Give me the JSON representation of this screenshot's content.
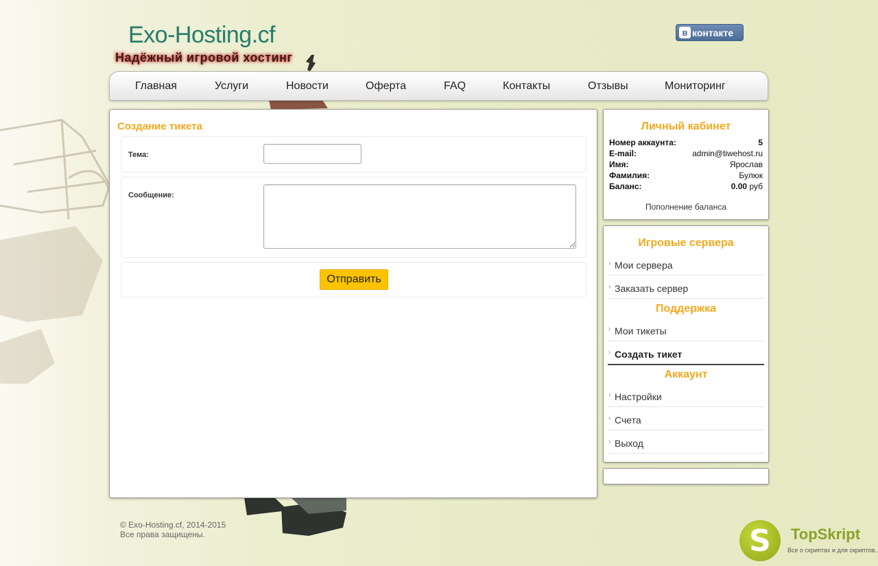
{
  "brand": {
    "title": "Exo-Hosting.cf",
    "tagline": "Надёжный игровой хостинг"
  },
  "social": {
    "vk_label": "контакте",
    "vk_letter": "в"
  },
  "nav": {
    "items": [
      "Главная",
      "Услуги",
      "Новости",
      "Оферта",
      "FAQ",
      "Контакты",
      "Отзывы",
      "Мониторинг"
    ]
  },
  "ticket_form": {
    "title": "Создание тикета",
    "subject_label": "Тема:",
    "subject_value": "",
    "message_label": "Сообщение:",
    "message_value": "",
    "submit_label": "Отправить"
  },
  "account": {
    "title": "Личный кабинет",
    "rows": [
      {
        "key": "Номер аккаунта:",
        "value": "5"
      },
      {
        "key": "E-mail:",
        "value": "admin@tiwehost.ru"
      },
      {
        "key": "Имя:",
        "value": "Ярослав"
      },
      {
        "key": "Фамилия:",
        "value": "Булюк"
      },
      {
        "key": "Баланс:",
        "value": "0.00",
        "unit": "руб"
      }
    ],
    "topup_label": "Пополнение баланса"
  },
  "sidebar": {
    "servers_title": "Игровые сервера",
    "servers_items": [
      "Мои сервера",
      "Заказать сервер"
    ],
    "support_title": "Поддержка",
    "support_items": [
      "Мои тикеты",
      "Создать тикет"
    ],
    "account_title": "Аккаунт",
    "account_items": [
      "Настройки",
      "Счета",
      "Выход"
    ],
    "active_item": "Создать тикет"
  },
  "footer": {
    "copyright": "© Exo-Hosting.cf, 2014-2015",
    "rights": "Все права защищены."
  },
  "watermark": {
    "letter": "S",
    "name": "TopSkript",
    "tagline": "Все о скриптах и для скриптов..."
  },
  "colors": {
    "accent": "#f4a81d",
    "button": "#fbc300",
    "vk": "#4b6d98",
    "logo": "#2c7a6a"
  }
}
